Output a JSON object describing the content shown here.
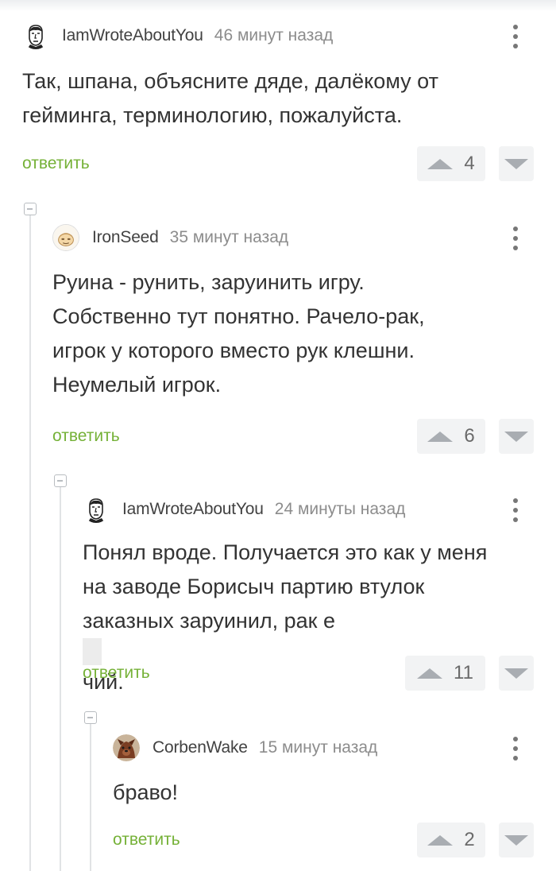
{
  "comments": [
    {
      "author": "IamWroteAboutYou",
      "time": "46 минут назад",
      "text_lines": [
        "Так, шпана, объясните дяде, далёкому от",
        "гейминга, терминологию, пожалуйста."
      ],
      "reply_label": "ответить",
      "votes": "4",
      "avatar_icon": "man-portrait-avatar-icon"
    },
    {
      "author": "IronSeed",
      "time": "35 минут назад",
      "text_lines": [
        "Руина - рунить, заруинить игру.",
        "Собственно тут понятно. Рачело-рак,",
        "игрок у которого вместо рук клешни.",
        "Неумелый игрок."
      ],
      "reply_label": "ответить",
      "votes": "6",
      "avatar_icon": "cartoon-face-avatar-icon"
    },
    {
      "author": "IamWroteAboutYou",
      "time": "24 минуты назад",
      "text_lines": [
        "Понял вроде. Получается это как у меня",
        "на заводе Борисыч партию втулок"
      ],
      "text_line3_before": "заказных заруинил, рак е",
      "text_line3_after": "чий.",
      "reply_label": "ответить",
      "votes": "11",
      "avatar_icon": "man-portrait-avatar-icon"
    },
    {
      "author": "CorbenWake",
      "time": "15 минут назад",
      "text_lines": [
        "браво!"
      ],
      "reply_label": "ответить",
      "votes": "2",
      "avatar_icon": "dog-avatar-icon"
    }
  ],
  "colors": {
    "accent_green": "#75b137",
    "vote_bg": "#f2f3f4",
    "vote_arrow": "#a9adb2"
  }
}
